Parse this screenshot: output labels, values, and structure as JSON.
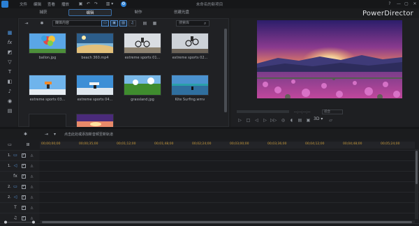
{
  "app": {
    "menus": [
      "文件",
      "编辑",
      "查看",
      "播放"
    ],
    "project_title": "未命名的新项目",
    "brand": "PowerDirector"
  },
  "modes": [
    {
      "label": "捕获",
      "active": false
    },
    {
      "label": "编辑",
      "active": true
    },
    {
      "label": "制作",
      "active": false
    },
    {
      "label": "创建光盘",
      "active": false
    }
  ],
  "left_tools": [
    {
      "icon": "media-room-icon",
      "glyph": "▦"
    },
    {
      "icon": "fx-icon",
      "glyph": "fx"
    },
    {
      "icon": "pip-icon",
      "glyph": "◩"
    },
    {
      "icon": "particle-icon",
      "glyph": "▽"
    },
    {
      "icon": "title-icon",
      "glyph": "T"
    },
    {
      "icon": "transition-icon",
      "glyph": "◧"
    },
    {
      "icon": "audio-mix-icon",
      "glyph": "♪"
    },
    {
      "icon": "voiceover-icon",
      "glyph": "🎙"
    },
    {
      "icon": "chapter-icon",
      "glyph": "▤"
    }
  ],
  "library": {
    "filter_value": "媒体内容",
    "search_placeholder": "搜索库",
    "items": [
      {
        "name": "ballon.jpg",
        "thumb": "balloons"
      },
      {
        "name": "beach 360.mp4",
        "thumb": "beach"
      },
      {
        "name": "extreme sports 01...",
        "thumb": "bike1"
      },
      {
        "name": "extreme sports 02...",
        "thumb": "bike2"
      },
      {
        "name": "extreme sports 03...",
        "thumb": "sky1"
      },
      {
        "name": "extreme sports 04...",
        "thumb": "sky2"
      },
      {
        "name": "grassland.jpg",
        "thumb": "grass"
      },
      {
        "name": "Kite Surfing.wmv",
        "thumb": "kite"
      },
      {
        "name": "",
        "thumb": "dark"
      },
      {
        "name": "",
        "thumb": "sunset"
      }
    ]
  },
  "preview": {
    "timecode": "--;--;--;--",
    "zoom": "适合",
    "label_3d": "3D"
  },
  "timeline": {
    "hint": "点击此处或添加新音频至新轨道",
    "ruler_ticks": [
      "00;00;00;00",
      "00;00;35;00",
      "00;01;12;00",
      "00;01;48;00",
      "00;02;24;00",
      "00;03;00;00",
      "00;03;36;00",
      "00;04;12;00",
      "00;04;48;00",
      "00;05;24;00"
    ],
    "tracks": [
      {
        "num": "1.",
        "icon": "video-track-icon",
        "glyph": "▭",
        "plain": false
      },
      {
        "num": "1.",
        "icon": "audio-track-icon",
        "glyph": "◁",
        "plain": false
      },
      {
        "num": "",
        "icon": "fx-track-icon",
        "glyph": "fx",
        "plain": true
      },
      {
        "num": "2.",
        "icon": "video-track-icon",
        "glyph": "▭",
        "plain": false
      },
      {
        "num": "2.",
        "icon": "audio-track-icon",
        "glyph": "◁",
        "plain": false
      },
      {
        "num": "",
        "icon": "title-track-icon",
        "glyph": "T",
        "plain": true
      },
      {
        "num": "",
        "icon": "voice-track-icon",
        "glyph": "♫",
        "plain": true
      },
      {
        "num": "",
        "icon": "music-track-icon",
        "glyph": "♪",
        "plain": true
      }
    ]
  }
}
